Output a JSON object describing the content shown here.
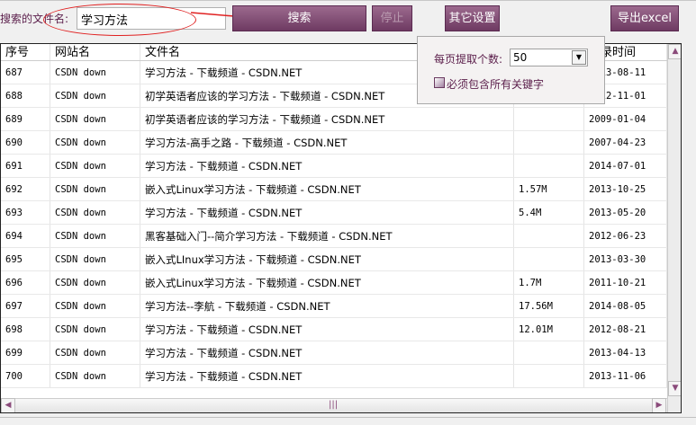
{
  "toolbar": {
    "label": "搜索的文件名:",
    "search_value": "学习方法",
    "search_button": "搜索",
    "stop_button": "停止",
    "settings_button": "其它设置",
    "export_button": "导出excel"
  },
  "table": {
    "headers": [
      "序号",
      "网站名",
      "文件名",
      "",
      "收录时间"
    ],
    "rows": [
      [
        "687",
        "CSDN down",
        "学习方法 - 下载频道 - CSDN.NET",
        "",
        "2013-08-11"
      ],
      [
        "688",
        "CSDN down",
        "初学英语者应该的学习方法 - 下载频道 - CSDN.NET",
        "",
        "2012-11-01"
      ],
      [
        "689",
        "CSDN down",
        "初学英语者应该的学习方法 - 下载频道 - CSDN.NET",
        "",
        "2009-01-04"
      ],
      [
        "690",
        "CSDN down",
        "学习方法-高手之路 - 下载频道 - CSDN.NET",
        "",
        "2007-04-23"
      ],
      [
        "691",
        "CSDN down",
        "学习方法 - 下载频道 - CSDN.NET",
        "",
        "2014-07-01"
      ],
      [
        "692",
        "CSDN down",
        "嵌入式Linux学习方法 - 下载频道 - CSDN.NET",
        "1.57M",
        "2013-10-25"
      ],
      [
        "693",
        "CSDN down",
        "学习方法 - 下载频道 - CSDN.NET",
        "5.4M",
        "2013-05-20"
      ],
      [
        "694",
        "CSDN down",
        "黑客基础入门--简介学习方法 - 下载频道 - CSDN.NET",
        "",
        "2012-06-23"
      ],
      [
        "695",
        "CSDN down",
        "嵌入式LInux学习方法 - 下载频道 - CSDN.NET",
        "",
        "2013-03-30"
      ],
      [
        "696",
        "CSDN down",
        "嵌入式Linux学习方法 - 下载频道 - CSDN.NET",
        "1.7M",
        "2011-10-21"
      ],
      [
        "697",
        "CSDN down",
        "学习方法--李航 - 下载频道 - CSDN.NET",
        "17.56M",
        "2014-08-05"
      ],
      [
        "698",
        "CSDN down",
        "学习方法 - 下载频道 - CSDN.NET",
        "12.01M",
        "2012-08-21"
      ],
      [
        "699",
        "CSDN down",
        "学习方法 - 下载频道 - CSDN.NET",
        "",
        "2013-04-13"
      ],
      [
        "700",
        "CSDN down",
        "学习方法 - 下载频道 - CSDN.NET",
        "",
        "2013-11-06"
      ]
    ]
  },
  "popup": {
    "per_page_label": "每页提取个数:",
    "per_page_value": "50",
    "match_all_label": "必须包含所有关键字",
    "match_all_checked": false
  },
  "colors": {
    "accent": "#7a4470",
    "annotation": "#e02020"
  }
}
